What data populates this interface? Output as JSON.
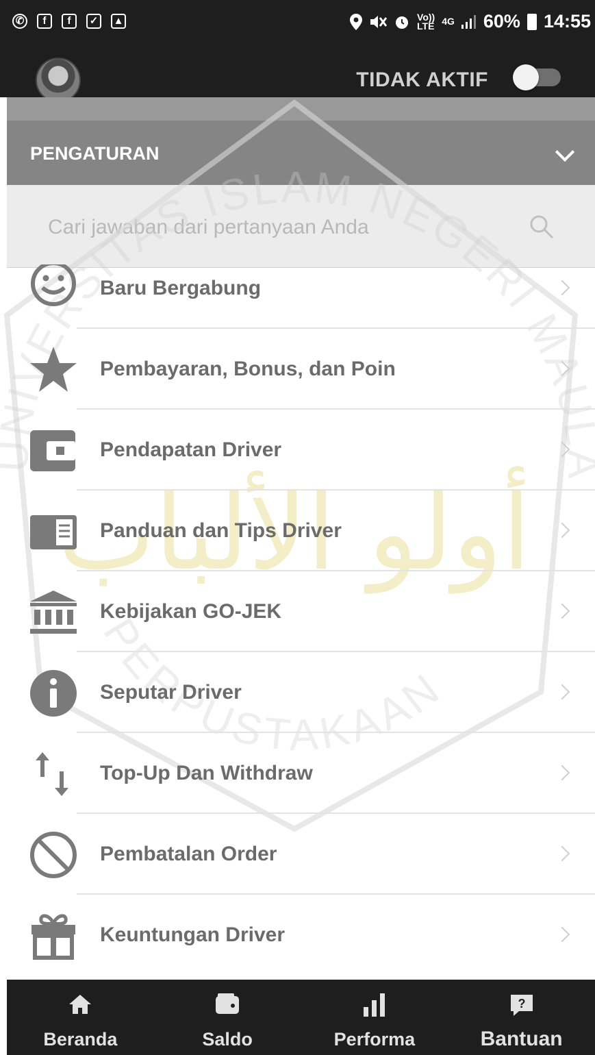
{
  "status_bar": {
    "left_icons": [
      "whatsapp-icon",
      "facebook-icon",
      "facebook-icon",
      "checkbox-icon",
      "image-icon"
    ],
    "right_icons": [
      "location-icon",
      "mute-icon",
      "alarm-icon"
    ],
    "volte": "Vo))",
    "lte": "LTE",
    "network": "4G",
    "battery": "60%",
    "time": "14:55"
  },
  "header": {
    "status_label": "TIDAK AKTIF",
    "toggle_on": false
  },
  "section": {
    "title": "PENGATURAN"
  },
  "search": {
    "placeholder": "Cari jawaban dari pertanyaan Anda"
  },
  "menu": [
    {
      "label": "Baru Bergabung",
      "icon": "smile-icon"
    },
    {
      "label": "Pembayaran, Bonus, dan Poin",
      "icon": "star-icon"
    },
    {
      "label": "Pendapatan Driver",
      "icon": "wallet-icon"
    },
    {
      "label": "Panduan dan Tips Driver",
      "icon": "book-icon"
    },
    {
      "label": "Kebijakan GO-JEK",
      "icon": "bank-icon"
    },
    {
      "label": "Seputar Driver",
      "icon": "info-icon"
    },
    {
      "label": "Top-Up Dan Withdraw",
      "icon": "transfer-arrows-icon"
    },
    {
      "label": "Pembatalan Order",
      "icon": "cancel-icon"
    },
    {
      "label": "Keuntungan Driver",
      "icon": "gift-icon"
    }
  ],
  "bottom_nav": [
    {
      "label": "Beranda",
      "icon": "home-icon"
    },
    {
      "label": "Saldo",
      "icon": "wallet-icon"
    },
    {
      "label": "Performa",
      "icon": "bar-chart-icon"
    },
    {
      "label": "Bantuan",
      "icon": "help-icon"
    }
  ],
  "watermark": {
    "arc_text": "UNIVERSITAS ISLAM NEGERI MAULANA MALIK IBRAHIM",
    "bottom_text": "PERPUSTAKAAN",
    "center_text": "أولو الألباب",
    "color": "#d9c94a"
  },
  "colors": {
    "bar_dark": "#1e1e1e",
    "header_gray": "#858585",
    "text_gray": "#6b6b6b"
  }
}
